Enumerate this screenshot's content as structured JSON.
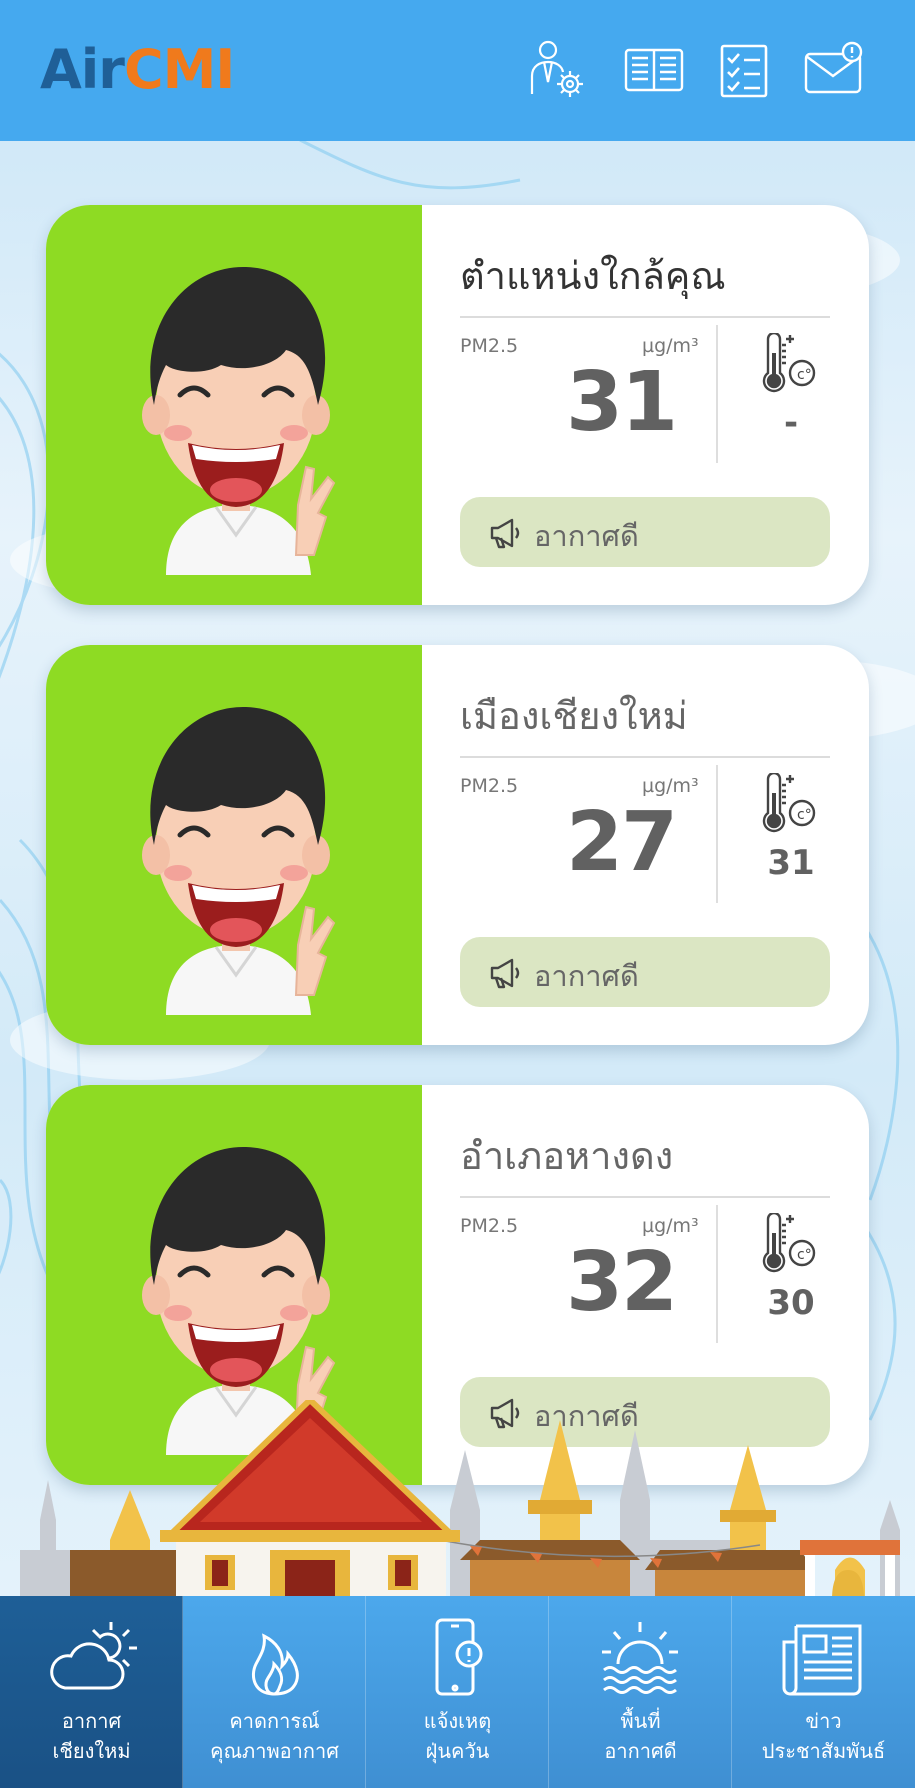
{
  "header": {
    "logo_air": "Air",
    "logo_cmi": "CMI",
    "icons": [
      "user-settings-icon",
      "book-icon",
      "checklist-icon",
      "mail-alert-icon"
    ]
  },
  "stations": [
    {
      "title": "ตำแหน่งใกล้คุณ",
      "pm_label": "PM2.5",
      "pm_unit": "µg/m³",
      "pm_value": "31",
      "temp_value": "-",
      "status": "อากาศดี",
      "face_color": "#8edb23"
    },
    {
      "title": "เมืองเชียงใหม่",
      "pm_label": "PM2.5",
      "pm_unit": "µg/m³",
      "pm_value": "27",
      "temp_value": "31",
      "status": "อากาศดี",
      "face_color": "#8edb23"
    },
    {
      "title": "อำเภอหางดง",
      "pm_label": "PM2.5",
      "pm_unit": "µg/m³",
      "pm_value": "32",
      "temp_value": "30",
      "status": "อากาศดี",
      "face_color": "#8edb23"
    }
  ],
  "nav": [
    {
      "line1": "อากาศ",
      "line2": "เชียงใหม่",
      "icon": "cloud-sun-icon",
      "active": true
    },
    {
      "line1": "คาดการณ์",
      "line2": "คุณภาพอากาศ",
      "icon": "flame-icon",
      "active": false
    },
    {
      "line1": "แจ้งเหตุ",
      "line2": "ฝุ่นควัน",
      "icon": "phone-alert-icon",
      "active": false
    },
    {
      "line1": "พื้นที่",
      "line2": "อากาศดี",
      "icon": "sunrise-icon",
      "active": false
    },
    {
      "line1": "ข่าว",
      "line2": "ประชาสัมพันธ์",
      "icon": "newspaper-icon",
      "active": false
    }
  ],
  "colors": {
    "header_bg": "#45a9ef",
    "good_air": "#8edb23",
    "status_bg": "#dbe6c3",
    "nav_active": "#1e5f97"
  }
}
